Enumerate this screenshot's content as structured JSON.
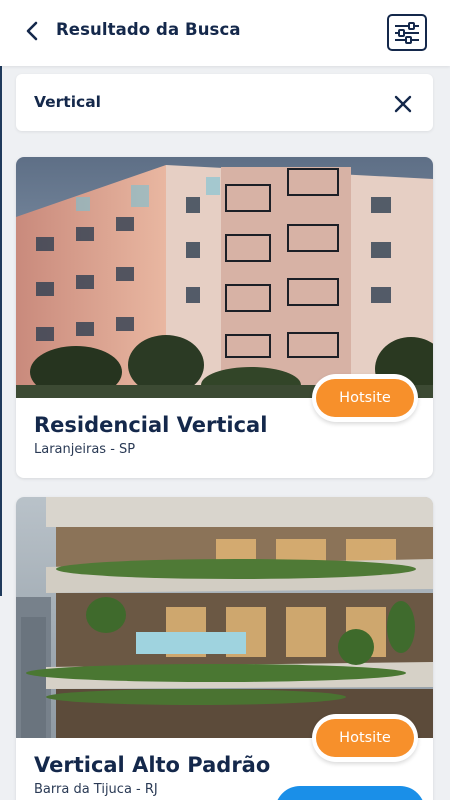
{
  "header": {
    "title": "Resultado da Busca",
    "back_icon": "chevron-left-icon",
    "filter_icon": "sliders-icon"
  },
  "search": {
    "value": "Vertical",
    "clear_icon": "close-icon"
  },
  "results": [
    {
      "name": "Residencial Vertical",
      "location": "Laranjeiras - SP",
      "button_label": "Hotsite"
    },
    {
      "name": "Vertical Alto Padrão",
      "location": "Barra da Tijuca - RJ",
      "button_label": "Hotsite"
    }
  ],
  "colors": {
    "primary": "#14284b",
    "accent": "#f7902b",
    "background": "#eef0f3",
    "fab": "#1a8fe8"
  }
}
